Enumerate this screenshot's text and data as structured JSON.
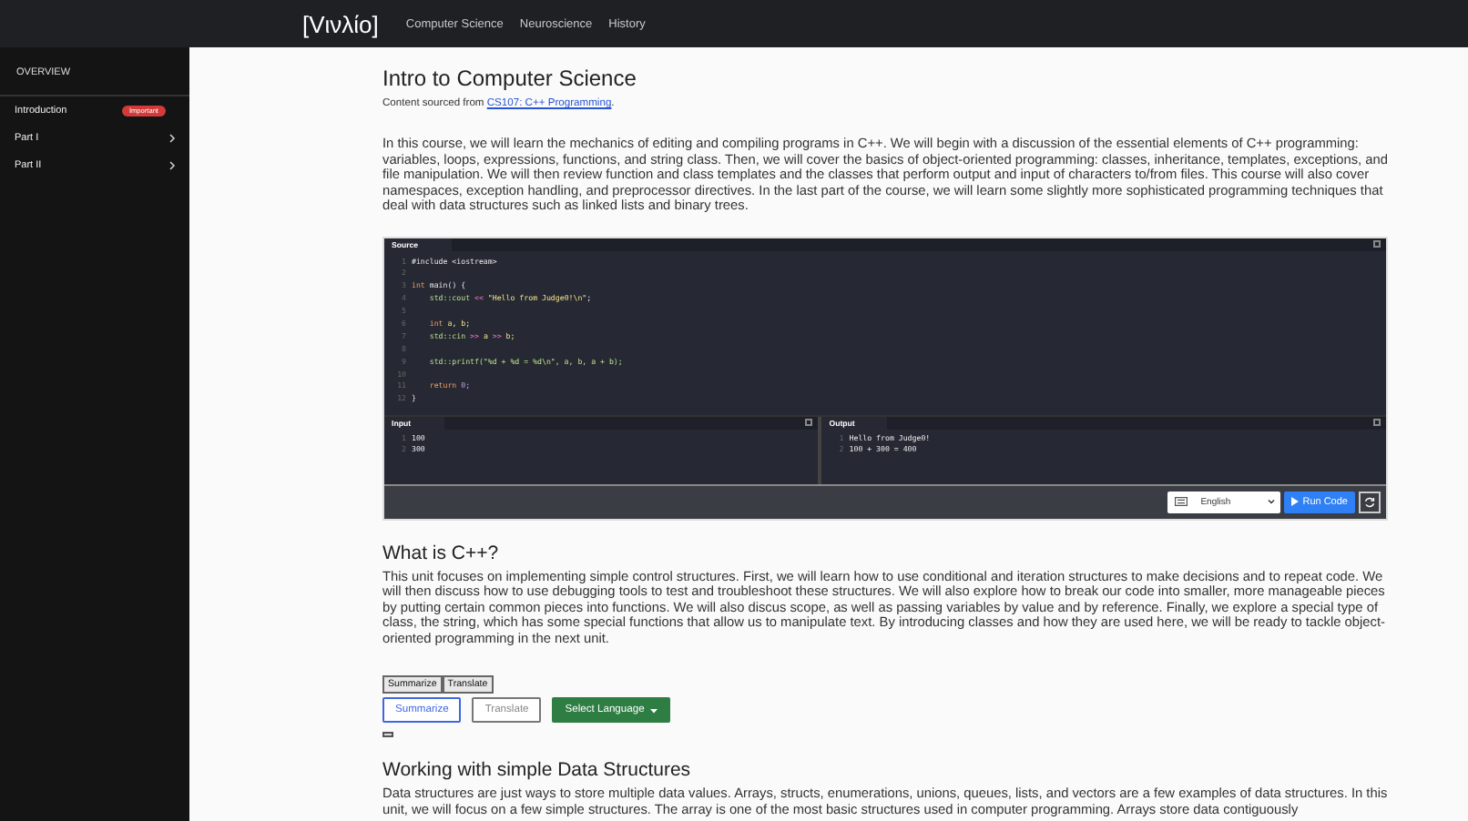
{
  "header": {
    "logo": "[Vινλίο]",
    "links": [
      "Computer Science",
      "Neuroscience",
      "History"
    ]
  },
  "sidebar": {
    "title": "OVERVIEW",
    "items": [
      {
        "label": "Introduction",
        "badge": "Important",
        "kind": "badge"
      },
      {
        "label": "Part I",
        "kind": "expandable",
        "expanded": false
      },
      {
        "label": "Part II",
        "kind": "expandable",
        "expanded": false
      }
    ]
  },
  "page": {
    "title": "Intro to Computer Science",
    "source_prefix": "Content sourced from ",
    "source_link": "CS107: C++ Programming",
    "source_suffix": ".",
    "intro": "In this course, we will learn the mechanics of editing and compiling programs in C++. We will begin with a discussion of the essential elements of C++ programming: variables, loops, expressions, functions, and string class. Then, we will cover the basics of object-oriented programming: classes, inheritance, templates, exceptions, and file manipulation. We will then review function and class templates and the classes that perform output and input of characters to/from files. This course will also cover namespaces, exception handling, and preprocessor directives. In the last part of the course, we will learn some slightly more sophisticated programming techniques that deal with data structures such as linked lists and binary trees."
  },
  "editor": {
    "source_label": "Source",
    "code": [
      {
        "number": "1",
        "tokens": [
          {
            "text": "#include <iostream>",
            "kind": "plain"
          }
        ]
      },
      {
        "number": "2"
      },
      {
        "number": "3",
        "tokens": [
          {
            "text": "int",
            "kind": "keyword"
          },
          {
            "text": " main() {",
            "kind": "plain"
          }
        ]
      },
      {
        "number": "4",
        "tokens": [
          {
            "text": "    std::cout ",
            "kind": "function"
          },
          {
            "text": "<<",
            "kind": "operator"
          },
          {
            "text": " \"Hello from Judge0!\\n\"",
            "kind": "string"
          },
          {
            "text": ";",
            "kind": "plain"
          }
        ]
      },
      {
        "number": "5"
      },
      {
        "number": "6",
        "tokens": [
          {
            "text": "    int",
            "kind": "keyword"
          },
          {
            "text": " a, b;",
            "kind": "string"
          }
        ]
      },
      {
        "number": "7",
        "tokens": [
          {
            "text": "    std::cin ",
            "kind": "function"
          },
          {
            "text": ">>",
            "kind": "operator"
          },
          {
            "text": " a ",
            "kind": "string"
          },
          {
            "text": ">>",
            "kind": "operator"
          },
          {
            "text": " b;",
            "kind": "string"
          }
        ]
      },
      {
        "number": "8"
      },
      {
        "number": "9",
        "tokens": [
          {
            "text": "    std::printf(\"%d + %d = %d\\n\", a, b, a + b);",
            "kind": "function"
          }
        ]
      },
      {
        "number": "10"
      },
      {
        "number": "11",
        "tokens": [
          {
            "text": "    return",
            "kind": "keyword"
          },
          {
            "text": " 0;",
            "kind": "number"
          }
        ]
      },
      {
        "number": "12",
        "tokens": [
          {
            "text": "}",
            "kind": "plain"
          }
        ]
      }
    ],
    "input_label": "Input",
    "input": [
      {
        "number": "1",
        "text": "100"
      },
      {
        "number": "2",
        "text": "300"
      }
    ],
    "output_label": "Output",
    "output": [
      {
        "number": "1",
        "text": "Hello from Judge0!"
      },
      {
        "number": "2",
        "text": "100 + 300 = 400"
      }
    ],
    "language": "English",
    "run_label": "Run Code"
  },
  "sections": [
    {
      "title": "What is C++?",
      "text": "This unit focuses on implementing simple control structures. First, we will learn how to use conditional and iteration structures to make decisions and to repeat code. We will then discuss how to use debugging tools to test and troubleshoot these structures. We will also explore how to break our code into smaller, more manageable pieces by putting certain common pieces into functions. We will also discus scope, as well as passing variables by value and by reference. Finally, we explore a special type of class, the string, which has some special functions that allow us to manipulate text. By introducing classes and how they are used here, we will be ready to tackle object-oriented programming in the next unit.",
      "plain_buttons": [
        "Summarize",
        "Translate"
      ],
      "toggle_on": false,
      "buttons": [
        {
          "label": "Summarize",
          "kind": "primary"
        },
        {
          "label": "Translate",
          "kind": "secondary"
        },
        {
          "label": "Select Language",
          "kind": "dropdown"
        }
      ]
    },
    {
      "title": "Working with simple Data Structures",
      "text": "Data structures are just ways to store multiple data values. Arrays, structs, enumerations, unions, queues, lists, and vectors are a few examples of data structures. In this unit, we will focus on a few simple structures. The array is one of the most basic structures used in computer programming. Arrays store data contiguously"
    }
  ]
}
